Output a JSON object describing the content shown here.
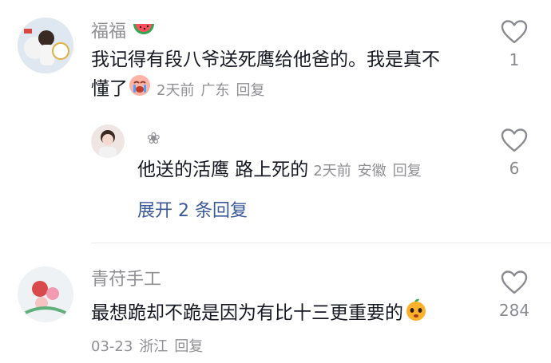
{
  "comments": [
    {
      "username": "福福",
      "text_line1": "我记得有段八爷送死鹰给他爸的。我是真不",
      "text_line2": "懂了",
      "meta": {
        "time": "2天前",
        "location": "广东",
        "reply": "回复"
      },
      "likes": "1"
    },
    {
      "username": "❀",
      "text": "他送的活鹰 路上死的",
      "meta": {
        "time": "2天前",
        "location": "安徽",
        "reply": "回复"
      },
      "likes": "6"
    },
    {
      "username": "青苻手工",
      "text": "最想跪却不跪是因为有比十三更重要的",
      "meta": {
        "time": "03-23",
        "location": "浙江",
        "reply": "回复"
      },
      "likes": "284"
    }
  ],
  "expand_label": "展开 2 条回复",
  "colors": {
    "text": "#161823",
    "secondary": "#8f8f94",
    "link": "#3b5999"
  }
}
